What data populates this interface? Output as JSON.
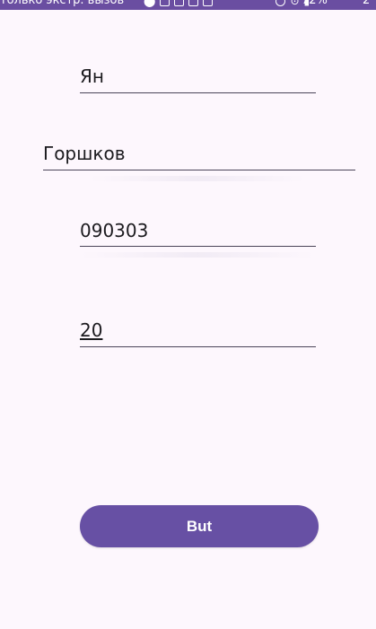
{
  "status_bar": {
    "carrier_text": "только экстр. вызов",
    "battery": "72%",
    "time": "2",
    "background_color": "#6a4ea1"
  },
  "form": {
    "first_name": "Ян",
    "last_name": "Горшков",
    "code": "090303",
    "number": "20"
  },
  "button": {
    "label": "But",
    "color": "#6750a4"
  }
}
